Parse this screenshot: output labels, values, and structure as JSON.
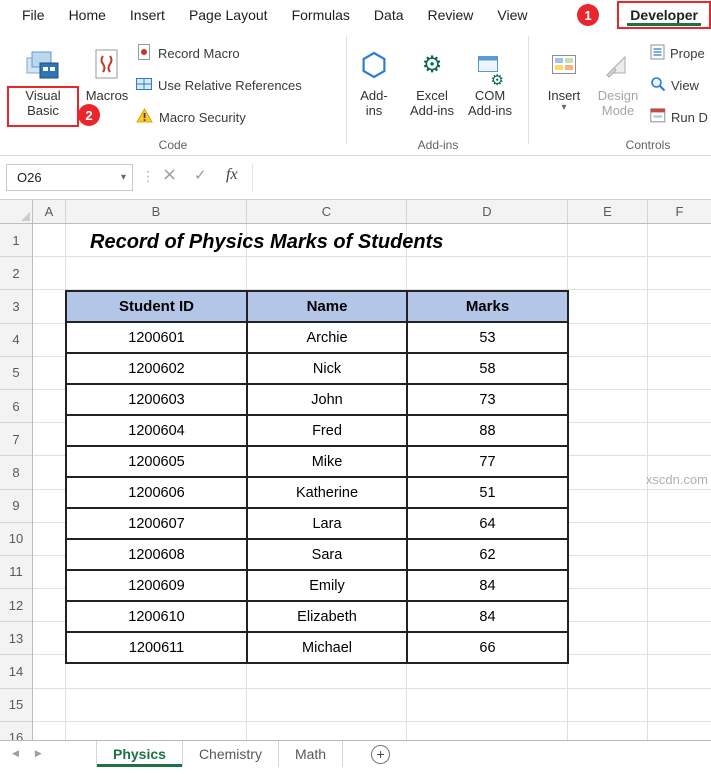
{
  "colors": {
    "annotation_red": "#e8262c",
    "excel_green": "#1e7145",
    "table_header_fill": "#b4c6e7"
  },
  "icons": {
    "dropdown": "▾",
    "dots": "⋮",
    "left": "◀",
    "right": "▶",
    "plus": "+",
    "gear": "⚙"
  },
  "annotations": {
    "step1": "1",
    "step2": "2"
  },
  "menu": {
    "items": [
      {
        "label": "File"
      },
      {
        "label": "Home"
      },
      {
        "label": "Insert"
      },
      {
        "label": "Page Layout"
      },
      {
        "label": "Formulas"
      },
      {
        "label": "Data"
      },
      {
        "label": "Review"
      },
      {
        "label": "View"
      },
      {
        "label": "Developer",
        "active": true
      }
    ]
  },
  "ribbon": {
    "visual_basic": "Visual Basic",
    "macros": "Macros",
    "record_macro": "Record Macro",
    "use_relative_references": "Use Relative References",
    "macro_security": "Macro Security",
    "code_group": "Code",
    "add_ins": "Add-ins",
    "excel_add_ins": "Excel Add-ins",
    "com_add_ins": "COM Add-ins",
    "addins_group": "Add-ins",
    "insert": "Insert",
    "design_mode": "Design Mode",
    "controls_group": "Controls",
    "properties": "Prope",
    "view_code": "View",
    "run_dialog": "Run D"
  },
  "formula_bar": {
    "name_box": "O26",
    "cancel": "×",
    "enter": "✓",
    "fx": "fx",
    "formula": ""
  },
  "sheet": {
    "columns": [
      "A",
      "B",
      "C",
      "D",
      "E",
      "F"
    ],
    "rows": [
      "1",
      "2",
      "3",
      "4",
      "5",
      "6",
      "7",
      "8",
      "9",
      "10",
      "11",
      "12",
      "13",
      "14",
      "15",
      "16"
    ],
    "title": "Record of Physics Marks of Students",
    "table": {
      "headers": [
        "Student ID",
        "Name",
        "Marks"
      ],
      "rows": [
        [
          "1200601",
          "Archie",
          "53"
        ],
        [
          "1200602",
          "Nick",
          "58"
        ],
        [
          "1200603",
          "John",
          "73"
        ],
        [
          "1200604",
          "Fred",
          "88"
        ],
        [
          "1200605",
          "Mike",
          "77"
        ],
        [
          "1200606",
          "Katherine",
          "51"
        ],
        [
          "1200607",
          "Lara",
          "64"
        ],
        [
          "1200608",
          "Sara",
          "62"
        ],
        [
          "1200609",
          "Emily",
          "84"
        ],
        [
          "1200610",
          "Elizabeth",
          "84"
        ],
        [
          "1200611",
          "Michael",
          "66"
        ]
      ]
    }
  },
  "tabs": {
    "items": [
      {
        "label": "Physics",
        "active": true
      },
      {
        "label": "Chemistry"
      },
      {
        "label": "Math"
      }
    ]
  },
  "watermark": "xscdn.com"
}
